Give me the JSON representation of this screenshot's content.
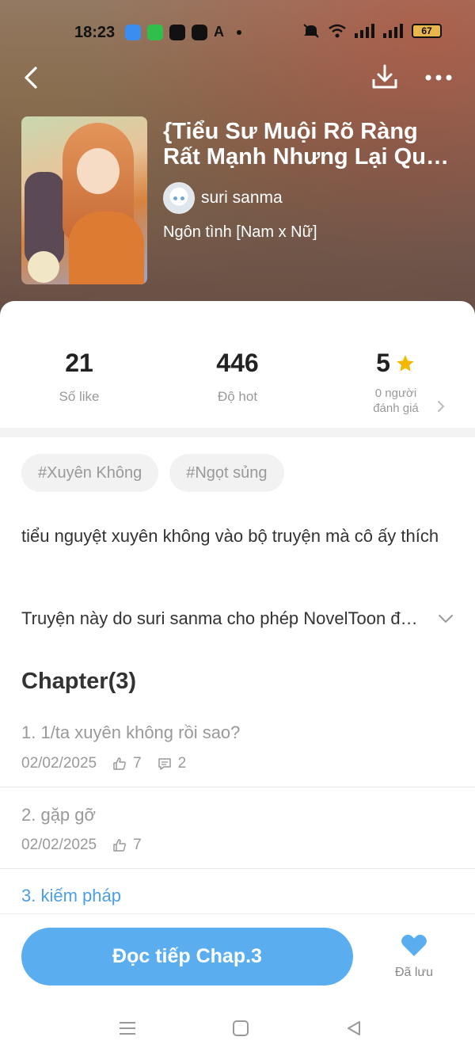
{
  "status_bar": {
    "time": "18:23",
    "battery": "67"
  },
  "book": {
    "title": "{Tiểu Sư Muội Rõ Ràng Rất Mạnh Nhưng Lại Quá Tấu Hề}",
    "author": "suri sanma",
    "genre": "Ngôn tình [Nam x Nữ]"
  },
  "stats": {
    "likes": {
      "value": "21",
      "label": "Số like"
    },
    "hot": {
      "value": "446",
      "label": "Độ hot"
    },
    "rating": {
      "value": "5",
      "label_line1": "0 người",
      "label_line2": "đánh giá"
    }
  },
  "tags": [
    "#Xuyên Không",
    "#Ngọt sủng"
  ],
  "description": "tiểu nguyệt xuyên không vào bộ truyện mà cô ấy thích",
  "permission": "Truyện này do suri sanma cho phép NovelToon đăng tải độc quyền",
  "chapters_heading": "Chapter(3)",
  "chapters": [
    {
      "name": "1. 1/ta xuyên không rồi sao?",
      "date": "02/02/2025",
      "likes": "7",
      "comments": "2"
    },
    {
      "name": "2. gặp gỡ",
      "date": "02/02/2025",
      "likes": "7"
    },
    {
      "name": "3. kiếm pháp"
    }
  ],
  "bottom": {
    "read_button": "Đọc tiếp Chap.3",
    "saved_label": "Đã lưu"
  },
  "colors": {
    "accent": "#5aaef0",
    "active_chapter": "#4a9fe8",
    "star": "#f5b800"
  }
}
